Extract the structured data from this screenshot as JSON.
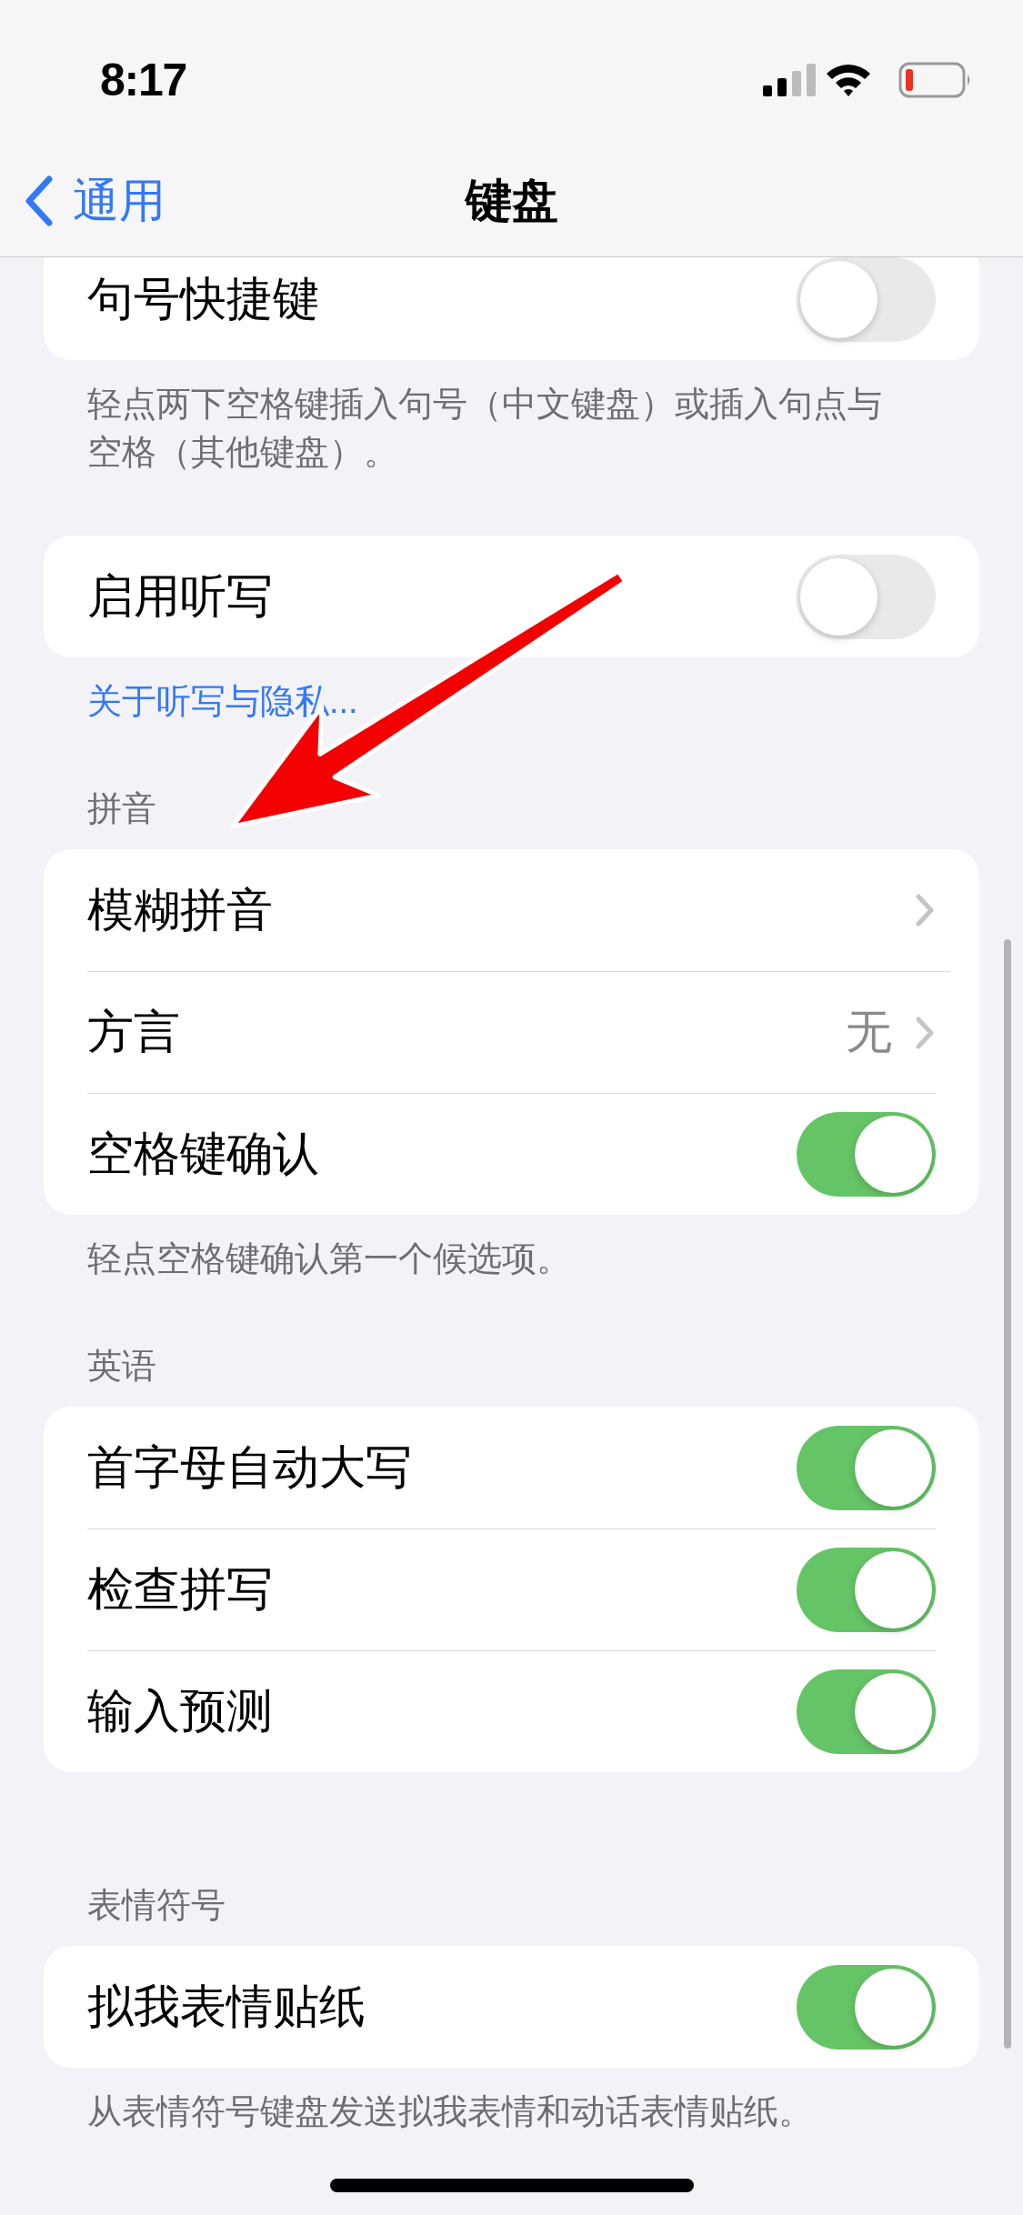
{
  "status_bar": {
    "time": "8:17"
  },
  "nav": {
    "back": "通用",
    "title": "键盘"
  },
  "sections": [
    {
      "rows": [
        {
          "kind": "toggle",
          "label": "句号快捷键",
          "on": false
        }
      ],
      "footer": "轻点两下空格键插入句号（中文键盘）或插入句点与空格（其他键盘）。"
    },
    {
      "rows": [
        {
          "kind": "toggle",
          "label": "启用听写",
          "on": false
        }
      ],
      "link": "关于听写与隐私..."
    },
    {
      "header": "拼音",
      "rows": [
        {
          "kind": "link",
          "label": "模糊拼音"
        },
        {
          "kind": "link",
          "label": "方言",
          "value": "无"
        },
        {
          "kind": "toggle",
          "label": "空格键确认",
          "on": true
        }
      ],
      "footer": "轻点空格键确认第一个候选项。"
    },
    {
      "header": "英语",
      "rows": [
        {
          "kind": "toggle",
          "label": "首字母自动大写",
          "on": true
        },
        {
          "kind": "toggle",
          "label": "检查拼写",
          "on": true
        },
        {
          "kind": "toggle",
          "label": "输入预测",
          "on": true
        }
      ]
    },
    {
      "header": "表情符号",
      "rows": [
        {
          "kind": "toggle",
          "label": "拟我表情贴纸",
          "on": true
        }
      ],
      "footer": "从表情符号键盘发送拟我表情和动话表情贴纸。"
    }
  ]
}
